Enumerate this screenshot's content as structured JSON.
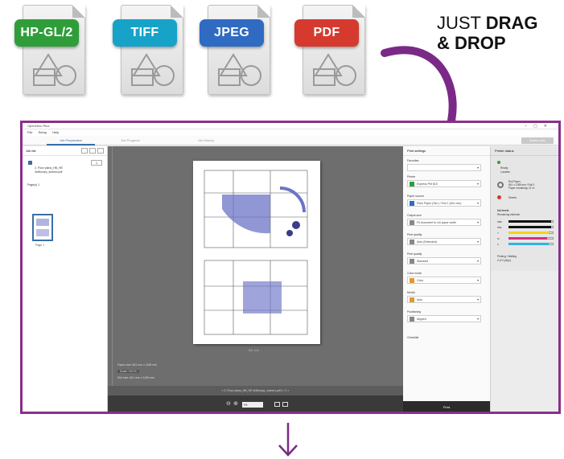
{
  "file_types": [
    {
      "label": "HP-GL/2",
      "color": "#2f9e3a"
    },
    {
      "label": "TIFF",
      "color": "#17a3c8"
    },
    {
      "label": "JPEG",
      "color": "#2f6bc2"
    },
    {
      "label": "PDF",
      "color": "#d63a2f"
    }
  ],
  "headline": {
    "line1_plain": "JUST ",
    "line1_bold": "DRAG",
    "line2_bold": "& DROP"
  },
  "accent_color": "#8a2e8c",
  "app": {
    "title": "OpenHero Plus",
    "menu": [
      "File",
      "Setup",
      "Help"
    ],
    "tabs": [
      {
        "label": "Job Preparation",
        "active": true
      },
      {
        "label": "Job Progress",
        "active": false
      },
      {
        "label": "Job History",
        "active": false
      }
    ],
    "top_right_button": "Amend Jobs",
    "job_list": {
      "heading": "Job list",
      "quantity": "1",
      "file_name": "2. Floor plans_HB_HE 3rdfloorpc_sneenv.pdf",
      "pages_label": "Page(s) 1",
      "thumb_label": "Page 1"
    },
    "preview": {
      "paper_size": "841 mm",
      "paper_info_1": "Paper size: 841 mm x 1189 mm",
      "paper_info_2": "Scale: 100 %",
      "paper_info_3": "Roll size: 841 mm x 1189 mm",
      "page_nav": "<    2. Floor plans_HB_HE 3rdfloorpc_sneenv.pdf  1 / 1    >",
      "zoom_value": "Fit"
    },
    "print_settings": {
      "heading": "Print settings",
      "printer_label": "Favorites",
      "fields": [
        {
          "label": "Printer",
          "value": "Express PM 815",
          "swatch": "#2f9e3a"
        },
        {
          "label": "Paper source",
          "value": "Plain Paper (Std.) / Roll 1 (841 mm)",
          "swatch": "#2f6bc2"
        },
        {
          "label": "Output size",
          "value": "Fit document to roll paper width",
          "swatch": "#888888"
        },
        {
          "label": "Print quality",
          "value": "Auto (Extended)",
          "swatch": "#888888"
        },
        {
          "label": "Print quality",
          "value": "Standard",
          "swatch": "#888888"
        },
        {
          "label": "Color mode",
          "value": "Color",
          "swatch": "#e09a2b"
        },
        {
          "label": "Media",
          "value": "Auto",
          "swatch": "#e09a2b"
        },
        {
          "label": "Positioning",
          "value": "Aligned",
          "swatch": "#888888"
        }
      ],
      "checklist_label": "Checklist",
      "print_button": "Print"
    },
    "printer_status": {
      "heading": "Printer status",
      "state": "Ready",
      "state_sub": "Location",
      "roll_paper": "Roll Paper",
      "roll_detail": "841 x 1189 mm / Roll 1",
      "roll_remaining": "Paper remaining: 21 m",
      "tray": "Sheets",
      "ink_heading": "Ink levels",
      "ink_sub": "Remaining ink/toner",
      "inks": [
        {
          "name": "MBk",
          "level": 0.95,
          "color": "#111111"
        },
        {
          "name": "PBk",
          "level": 0.95,
          "color": "#111111"
        },
        {
          "name": "Y",
          "level": 0.9,
          "color": "#f2d21a"
        },
        {
          "name": "M",
          "level": 0.85,
          "color": "#d6307e"
        },
        {
          "name": "C",
          "level": 0.9,
          "color": "#2fb4e0"
        }
      ],
      "maint_heading": "Printing / Waiting",
      "maint_value": "0 of 0 job(s)"
    }
  }
}
